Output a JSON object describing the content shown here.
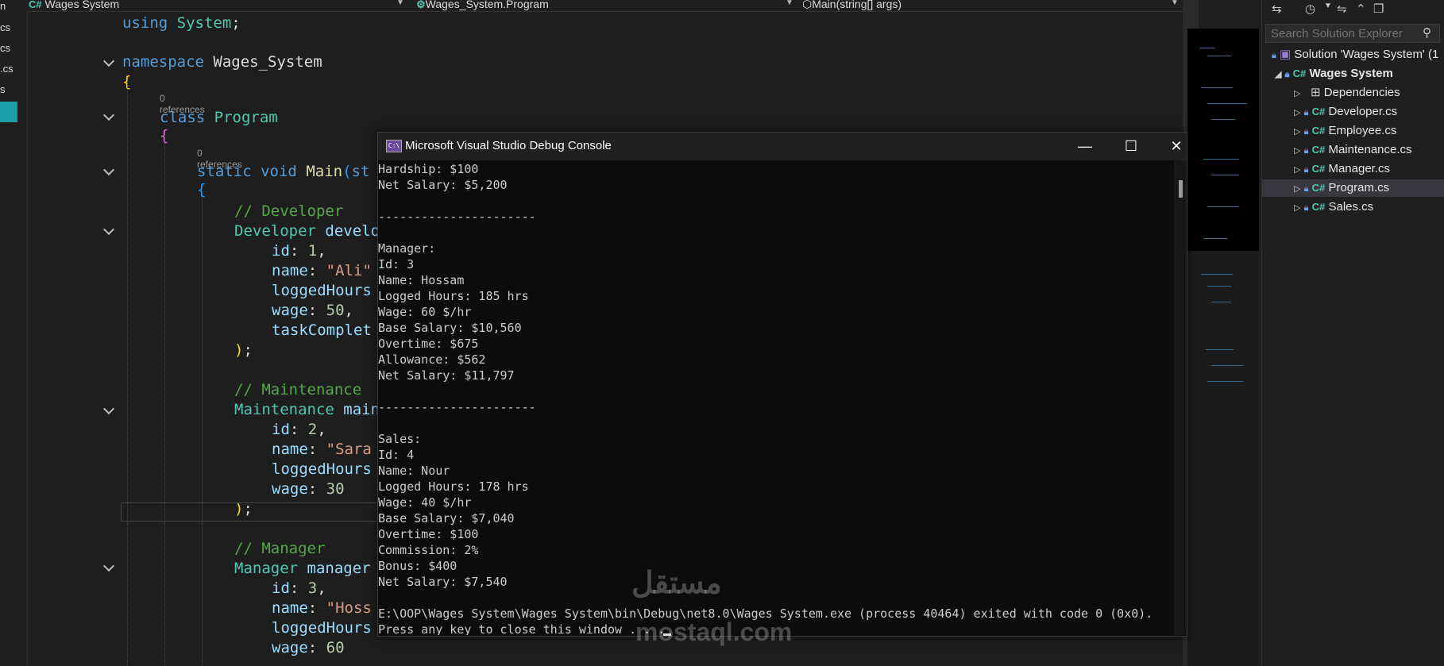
{
  "nav": {
    "project": "Wages System",
    "class": "Wages_System.Program",
    "method": "Main(string[] args)"
  },
  "left_tabs": [
    "n",
    "cs",
    "cs",
    ".cs",
    "s"
  ],
  "code": {
    "refs1": "0 references",
    "refs2": "0 references",
    "lines": [
      {
        "t": [
          [
            "kw",
            "using"
          ],
          [
            "pl",
            " "
          ],
          [
            "ty",
            "System"
          ],
          [
            "pl",
            ";"
          ]
        ]
      },
      {
        "t": [
          [
            "kw",
            "namespace"
          ],
          [
            "pl",
            " Wages_System"
          ]
        ]
      },
      {
        "t": [
          [
            "br1",
            "{"
          ]
        ]
      },
      {
        "t": [
          [
            "kw",
            "class"
          ],
          [
            "pl",
            " "
          ],
          [
            "ty",
            "Program"
          ]
        ]
      },
      {
        "t": [
          [
            "br2",
            "{"
          ]
        ]
      },
      {
        "t": [
          [
            "kw",
            "static"
          ],
          [
            "pl",
            " "
          ],
          [
            "kw",
            "void"
          ],
          [
            "pl",
            " "
          ],
          [
            "fn",
            "Main"
          ],
          [
            "br3",
            "("
          ],
          [
            "kw",
            "st"
          ]
        ]
      },
      {
        "t": [
          [
            "br3",
            "{"
          ]
        ]
      },
      {
        "t": [
          [
            "cm",
            "// Developer"
          ]
        ]
      },
      {
        "t": [
          [
            "ty",
            "Developer"
          ],
          [
            "pl",
            " "
          ],
          [
            "id",
            "develo"
          ]
        ]
      },
      {
        "t": [
          [
            "id",
            "id"
          ],
          [
            "pl",
            ": "
          ],
          [
            "nu",
            "1"
          ],
          [
            "pl",
            ","
          ]
        ]
      },
      {
        "t": [
          [
            "id",
            "name"
          ],
          [
            "pl",
            ": "
          ],
          [
            "st",
            "\"Ali\""
          ]
        ]
      },
      {
        "t": [
          [
            "id",
            "loggedHours"
          ]
        ]
      },
      {
        "t": [
          [
            "id",
            "wage"
          ],
          [
            "pl",
            ": "
          ],
          [
            "nu",
            "50"
          ],
          [
            "pl",
            ","
          ]
        ]
      },
      {
        "t": [
          [
            "id",
            "taskComplet"
          ]
        ]
      },
      {
        "t": [
          [
            "br1",
            ")"
          ],
          [
            "pl",
            ";"
          ]
        ]
      },
      {
        "t": [
          [
            "cm",
            "// Maintenance"
          ]
        ]
      },
      {
        "t": [
          [
            "ty",
            "Maintenance"
          ],
          [
            "pl",
            " "
          ],
          [
            "id",
            "main"
          ]
        ]
      },
      {
        "t": [
          [
            "id",
            "id"
          ],
          [
            "pl",
            ": "
          ],
          [
            "nu",
            "2"
          ],
          [
            "pl",
            ","
          ]
        ]
      },
      {
        "t": [
          [
            "id",
            "name"
          ],
          [
            "pl",
            ": "
          ],
          [
            "st",
            "\"Sara"
          ]
        ]
      },
      {
        "t": [
          [
            "id",
            "loggedHours"
          ]
        ]
      },
      {
        "t": [
          [
            "id",
            "wage"
          ],
          [
            "pl",
            ": "
          ],
          [
            "nu",
            "30"
          ]
        ]
      },
      {
        "t": [
          [
            "br1",
            ")"
          ],
          [
            "pl",
            ";"
          ]
        ]
      },
      {
        "t": [
          [
            "cm",
            "// Manager"
          ]
        ]
      },
      {
        "t": [
          [
            "ty",
            "Manager"
          ],
          [
            "pl",
            " "
          ],
          [
            "id",
            "manager"
          ]
        ]
      },
      {
        "t": [
          [
            "id",
            "id"
          ],
          [
            "pl",
            ": "
          ],
          [
            "nu",
            "3"
          ],
          [
            "pl",
            ","
          ]
        ]
      },
      {
        "t": [
          [
            "id",
            "name"
          ],
          [
            "pl",
            ": "
          ],
          [
            "st",
            "\"Hoss"
          ]
        ]
      },
      {
        "t": [
          [
            "id",
            "loggedHours"
          ]
        ]
      },
      {
        "t": [
          [
            "id",
            "wage"
          ],
          [
            "pl",
            ": "
          ],
          [
            "nu",
            "60"
          ]
        ]
      }
    ]
  },
  "explorer": {
    "search_placeholder": "Search Solution Explorer",
    "solution": "Solution 'Wages System' (1",
    "project": "Wages System",
    "items": [
      "Dependencies",
      "Developer.cs",
      "Employee.cs",
      "Maintenance.cs",
      "Manager.cs",
      "Program.cs",
      "Sales.cs"
    ]
  },
  "console": {
    "title": "Microsoft Visual Studio Debug Console",
    "minimize": "—",
    "maximize": "☐",
    "close": "✕",
    "lines": [
      "Hardship: $100",
      "Net Salary: $5,200",
      "",
      "----------------------",
      "",
      "Manager:",
      "Id: 3",
      "Name: Hossam",
      "Logged Hours: 185 hrs",
      "Wage: 60 $/hr",
      "Base Salary: $10,560",
      "Overtime: $675",
      "Allowance: $562",
      "Net Salary: $11,797",
      "",
      "----------------------",
      "",
      "Sales:",
      "Id: 4",
      "Name: Nour",
      "Logged Hours: 178 hrs",
      "Wage: 40 $/hr",
      "Base Salary: $7,040",
      "Overtime: $100",
      "Commission: 2%",
      "Bonus: $400",
      "Net Salary: $7,540",
      "",
      "E:\\OOP\\Wages System\\Wages System\\bin\\Debug\\net8.0\\Wages System.exe (process 40464) exited with code 0 (0x0).",
      "Press any key to close this window . . ."
    ]
  },
  "watermark": {
    "arabic": "مستقل",
    "latin": "mostaql.com"
  }
}
